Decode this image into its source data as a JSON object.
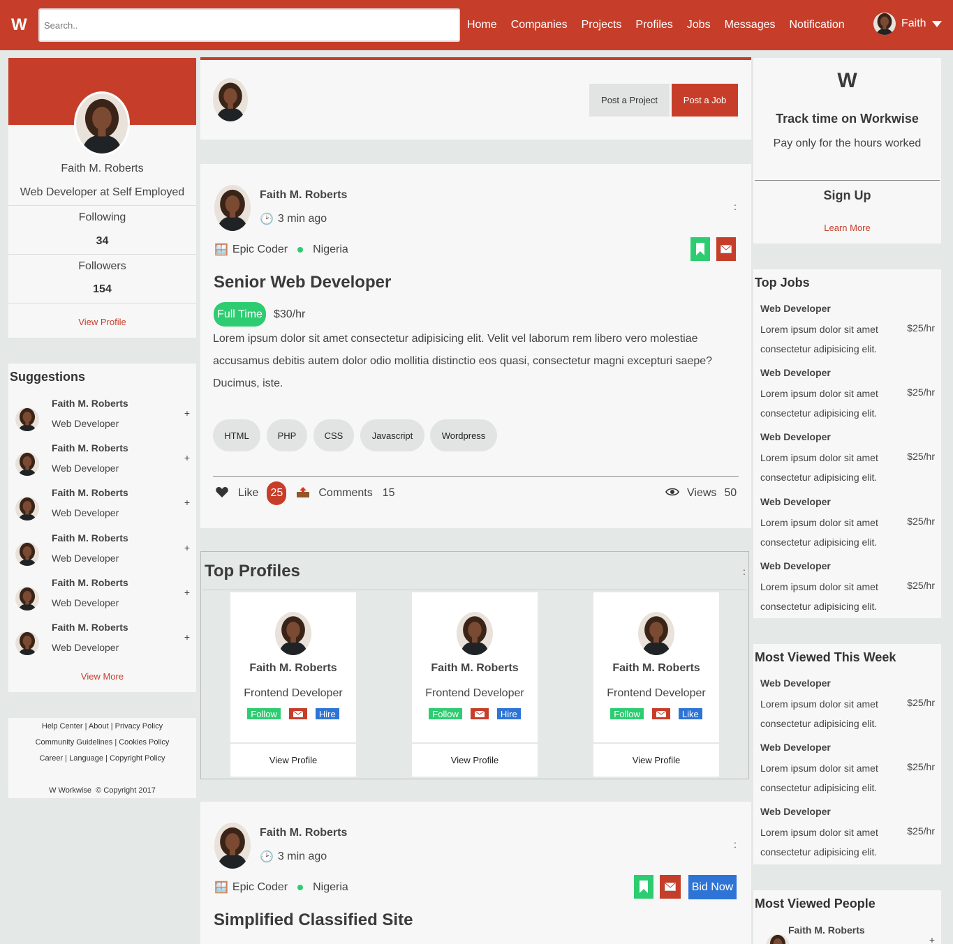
{
  "brand": "W",
  "search_placeholder": "Search..",
  "nav": [
    "Home",
    "Companies",
    "Projects",
    "Profiles",
    "Jobs",
    "Messages",
    "Notification"
  ],
  "user": {
    "name": "Faith"
  },
  "colors": {
    "brand": "#c63e2a",
    "green": "#2ecc71",
    "blue": "#2d74d6",
    "background": "#e4e8e6"
  },
  "profile": {
    "name": "Faith M. Roberts",
    "role": "Web Developer at Self Employed",
    "following_label": "Following",
    "following": "34",
    "followers_label": "Followers",
    "followers": "154",
    "view_profile": "View Profile"
  },
  "suggestions": {
    "title": "Suggestions",
    "items": [
      {
        "name": "Faith M. Roberts",
        "role": "Web Developer",
        "action": "+"
      },
      {
        "name": "Faith M. Roberts",
        "role": "Web Developer",
        "action": "+"
      },
      {
        "name": "Faith M. Roberts",
        "role": "Web Developer",
        "action": "+"
      },
      {
        "name": "Faith M. Roberts",
        "role": "Web Developer",
        "action": "+"
      },
      {
        "name": "Faith M. Roberts",
        "role": "Web Developer",
        "action": "+"
      },
      {
        "name": "Faith M. Roberts",
        "role": "Web Developer",
        "action": "+"
      }
    ],
    "view_more": "View More"
  },
  "footer": {
    "line1": "Help Center | About | Privacy Policy",
    "line2": "Community Guidelines | Cookies Policy",
    "line3": "Career | Language | Copyright Policy",
    "copyright": "W Workwise  © Copyright 2017"
  },
  "post_box": {
    "post_project": "Post a Project",
    "post_job": "Post a Job"
  },
  "post1": {
    "author": "Faith M. Roberts",
    "time": "3 min ago",
    "company": "Epic Coder",
    "location": "Nigeria",
    "menu": ":",
    "title": "Senior Web Developer",
    "type": "Full Time",
    "rate": "$30/hr",
    "description": "Lorem ipsum dolor sit amet consectetur adipisicing elit. Velit vel laborum rem libero vero molestiae accusamus debitis autem dolor odio mollitia distinctio eos quasi, consectetur magni excepturi saepe? Ducimus, iste.",
    "tags": [
      "HTML",
      "PHP",
      "CSS",
      "Javascript",
      "Wordpress"
    ],
    "like_label": "Like",
    "likes": "25",
    "comments_label": "Comments",
    "comments": "15",
    "views_label": "Views",
    "views": "50"
  },
  "top_profiles": {
    "title": "Top Profiles",
    "menu": ":",
    "cards": [
      {
        "name": "Faith M. Roberts",
        "role": "Frontend Developer",
        "follow": "Follow",
        "action": "Hire",
        "view": "View Profile"
      },
      {
        "name": "Faith M. Roberts",
        "role": "Frontend Developer",
        "follow": "Follow",
        "action": "Hire",
        "view": "View Profile"
      },
      {
        "name": "Faith M. Roberts",
        "role": "Frontend Developer",
        "follow": "Follow",
        "action": "Like",
        "view": "View Profile"
      }
    ]
  },
  "post2": {
    "author": "Faith M. Roberts",
    "time": "3 min ago",
    "company": "Epic Coder",
    "location": "Nigeria",
    "menu": ":",
    "bid": "Bid Now",
    "title": "Simplified Classified Site"
  },
  "promo": {
    "logo": "W",
    "title": "Track time on Workwise",
    "subtitle": "Pay only for the hours worked",
    "signup": "Sign Up",
    "learn_more": "Learn More"
  },
  "top_jobs": {
    "title": "Top Jobs",
    "items": [
      {
        "title": "Web Developer",
        "desc": "Lorem ipsum dolor sit amet consectetur adipisicing elit.",
        "rate": "$25/hr"
      },
      {
        "title": "Web Developer",
        "desc": "Lorem ipsum dolor sit amet consectetur adipisicing elit.",
        "rate": "$25/hr"
      },
      {
        "title": "Web Developer",
        "desc": "Lorem ipsum dolor sit amet consectetur adipisicing elit.",
        "rate": "$25/hr"
      },
      {
        "title": "Web Developer",
        "desc": "Lorem ipsum dolor sit amet consectetur adipisicing elit.",
        "rate": "$25/hr"
      },
      {
        "title": "Web Developer",
        "desc": "Lorem ipsum dolor sit amet consectetur adipisicing elit.",
        "rate": "$25/hr"
      }
    ]
  },
  "most_viewed": {
    "title": "Most Viewed This Week",
    "items": [
      {
        "title": "Web Developer",
        "desc": "Lorem ipsum dolor sit amet consectetur adipisicing elit.",
        "rate": "$25/hr"
      },
      {
        "title": "Web Developer",
        "desc": "Lorem ipsum dolor sit amet consectetur adipisicing elit.",
        "rate": "$25/hr"
      },
      {
        "title": "Web Developer",
        "desc": "Lorem ipsum dolor sit amet consectetur adipisicing elit.",
        "rate": "$25/hr"
      }
    ]
  },
  "most_viewed_people": {
    "title": "Most Viewed People",
    "items": [
      {
        "name": "Faith M. Roberts",
        "action": "+"
      }
    ]
  }
}
